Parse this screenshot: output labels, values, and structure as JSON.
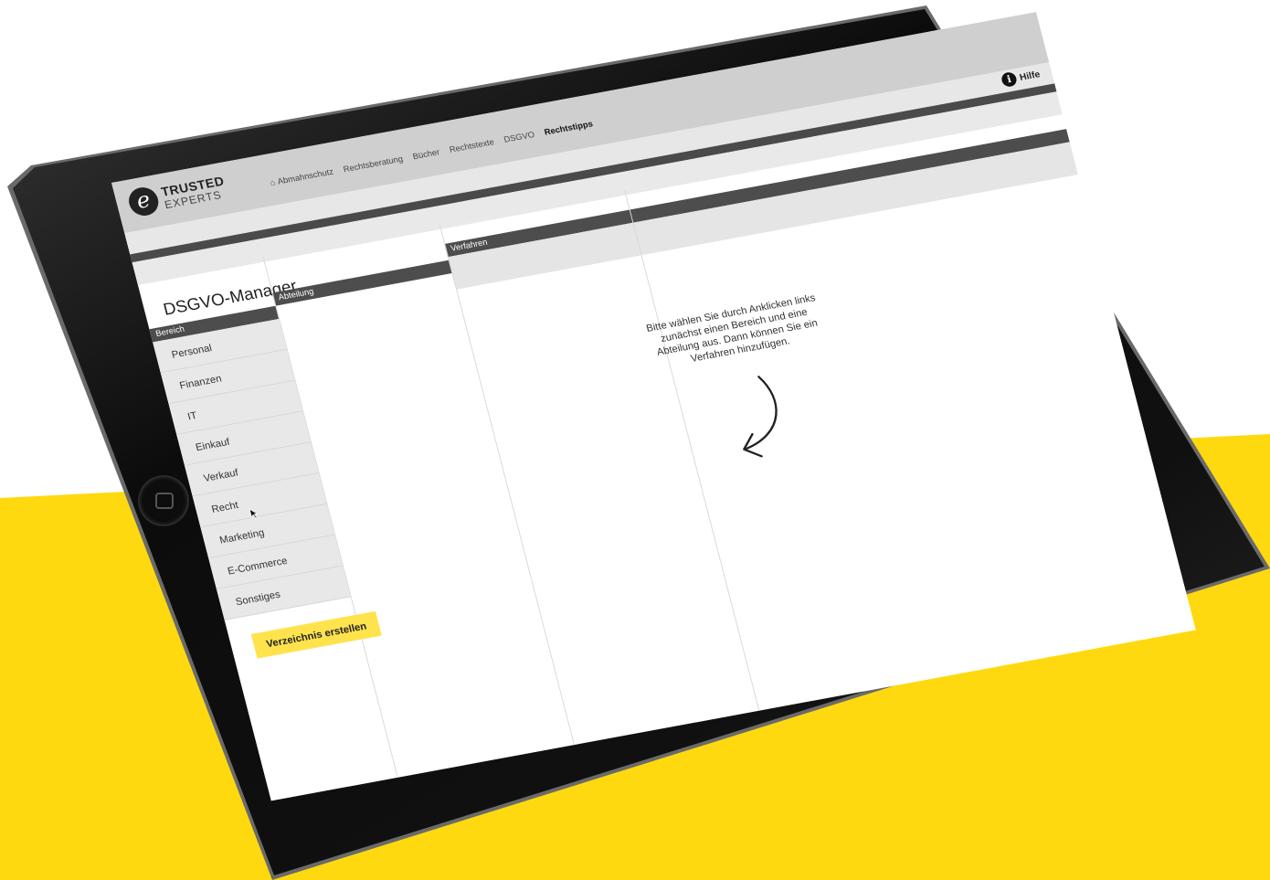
{
  "header": {
    "logo_initial": "e",
    "logo_line1": "TRUSTED",
    "logo_line2": "EXPERTS",
    "nav": [
      "Abmahnschutz",
      "Rechtsberatung",
      "Bücher",
      "Rechtstexte",
      "DSGVO",
      "Rechtstipps"
    ],
    "help_icon_glyph": "i",
    "help_label": "Hilfe"
  },
  "app": {
    "title": "DSGVO-Manager",
    "col_bereich": "Bereich",
    "col_abteilung": "Abteilung",
    "col_verfahren": "Verfahren"
  },
  "bereiche": [
    "Personal",
    "Finanzen",
    "IT",
    "Einkauf",
    "Verkauf",
    "Recht",
    "Marketing",
    "E-Commerce",
    "Sonstiges"
  ],
  "create_button": "Verzeichnis erstellen",
  "instruction": "Bitte wählen Sie durch Anklicken links zunächst einen Bereich und eine Abteilung aus. Dann können Sie ein Verfahren hinzufügen.",
  "colors": {
    "background_accent": "#ffd90f",
    "button": "#ffe34d",
    "header_dark": "#4d4d4d"
  }
}
